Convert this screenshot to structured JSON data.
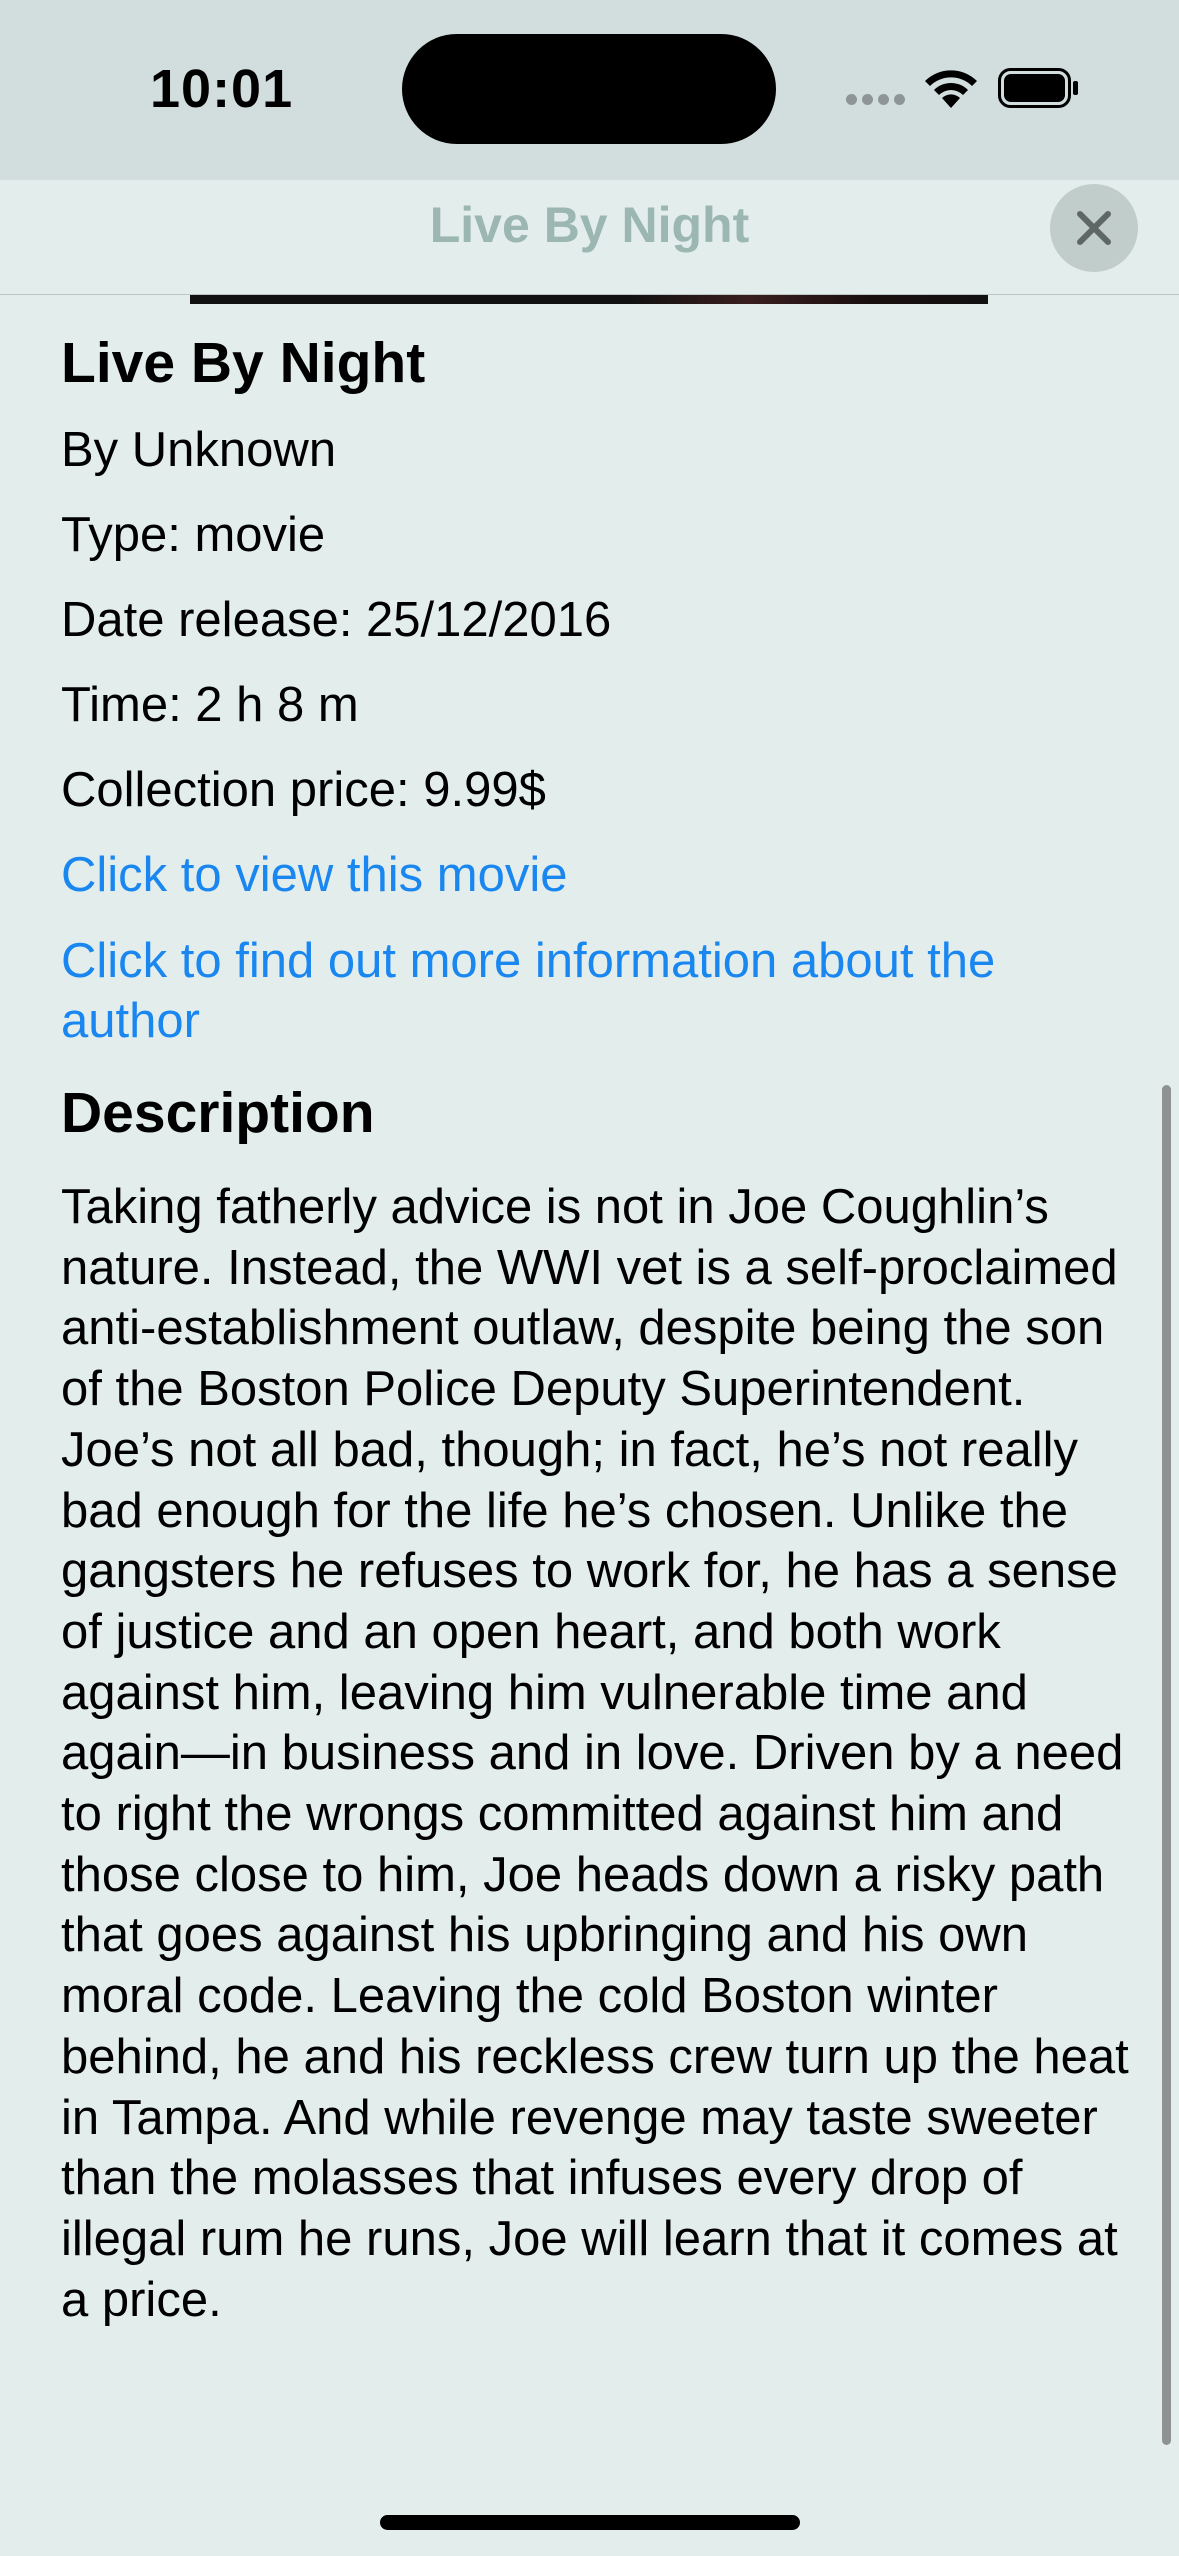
{
  "status_bar": {
    "time": "10:01"
  },
  "nav": {
    "title": "Live By Night"
  },
  "detail": {
    "title": "Live By Night",
    "author_line": "By Unknown",
    "type_line": "Type: movie",
    "date_line": "Date release: 25/12/2016",
    "time_line": "Time: 2 h 8 m",
    "price_line": "Collection price: 9.99$",
    "view_link": "Click to view this movie",
    "author_link": "Click to find out more information about the author"
  },
  "description": {
    "heading": "Description",
    "text": "Taking fatherly advice is not in Joe Coughlin’s nature. Instead, the WWI vet is a self-proclaimed anti-establishment outlaw, despite being the son of the Boston Police Deputy Superintendent. Joe’s not all bad, though; in fact, he’s not really bad enough for the life he’s chosen. Unlike the gangsters he refuses to work for, he has a sense of justice and an open heart, and both work against him, leaving him vulnerable time and again—in business and in love. Driven by a need to right the wrongs committed against him and those close to him, Joe heads down a risky path that goes against his upbringing and his own moral code. Leaving the cold Boston winter behind, he and his reckless crew turn up the heat in Tampa. And while revenge may taste sweeter than the molasses that infuses every drop of illegal rum he runs, Joe will learn that it comes at a price."
  },
  "icons": {
    "close": "close-icon",
    "wifi": "wifi-icon",
    "battery": "battery-icon",
    "signal": "cellular-signal-icon"
  },
  "colors": {
    "background": "#e3eeec",
    "nav_background": "#d2dedd",
    "link": "#1a86f0",
    "nav_title": "#9cb6b1"
  }
}
